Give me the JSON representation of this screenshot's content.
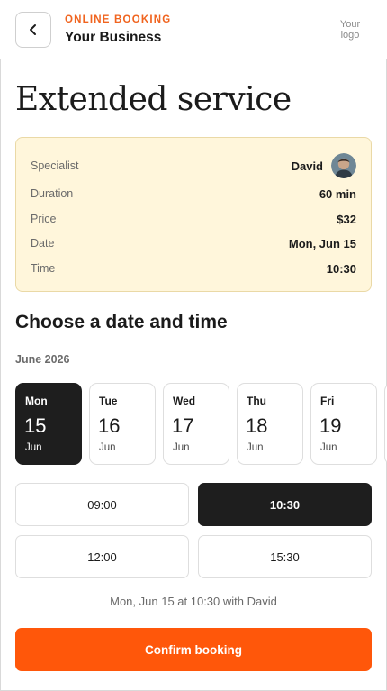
{
  "header": {
    "kicker": "ONLINE BOOKING",
    "business_name": "Your Business",
    "logo_text": "Your logo",
    "back_icon": "chevron-left-icon"
  },
  "service": {
    "title": "Extended service"
  },
  "summary": {
    "specialist_label": "Specialist",
    "specialist_value": "David",
    "duration_label": "Duration",
    "duration_value": "60 min",
    "price_label": "Price",
    "price_value": "$32",
    "date_label": "Date",
    "date_value": "Mon, Jun 15",
    "time_label": "Time",
    "time_value": "10:30"
  },
  "picker": {
    "title": "Choose a date and time",
    "month": "June 2026",
    "days": [
      {
        "dow": "Mon",
        "num": "15",
        "mon": "Jun",
        "selected": true
      },
      {
        "dow": "Tue",
        "num": "16",
        "mon": "Jun",
        "selected": false
      },
      {
        "dow": "Wed",
        "num": "17",
        "mon": "Jun",
        "selected": false
      },
      {
        "dow": "Thu",
        "num": "18",
        "mon": "Jun",
        "selected": false
      },
      {
        "dow": "Fri",
        "num": "19",
        "mon": "Jun",
        "selected": false
      }
    ],
    "times": [
      {
        "label": "09:00",
        "selected": false
      },
      {
        "label": "10:30",
        "selected": true
      },
      {
        "label": "12:00",
        "selected": false
      },
      {
        "label": "15:30",
        "selected": false
      }
    ]
  },
  "selection_text": "Mon, Jun 15 at 10:30 with David",
  "confirm_label": "Confirm booking",
  "colors": {
    "accent": "#ff570a",
    "kicker": "#f0641f",
    "summary_bg": "#fff6db",
    "selected_bg": "#1e1e1e"
  }
}
